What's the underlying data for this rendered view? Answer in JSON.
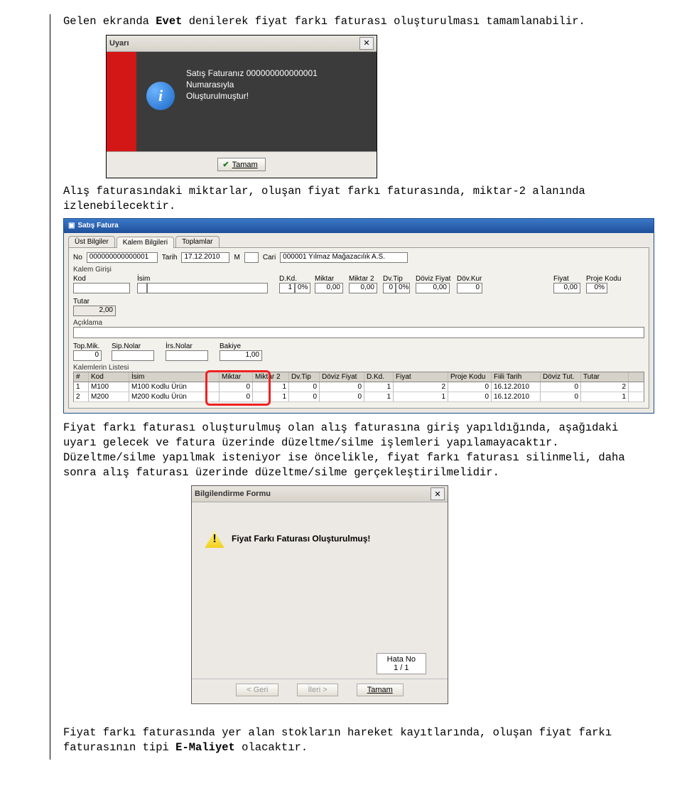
{
  "para1_a": "Gelen ekranda ",
  "para1_bold": "Evet",
  "para1_b": " denilerek fiyat farkı faturası oluşturulması tamamlanabilir.",
  "uyari": {
    "title": "Uyarı",
    "msg_line1": "Satış Faturanız 000000000000001 Numarasıyla",
    "msg_line2": "Oluşturulmuştur!",
    "tamam": "Tamam"
  },
  "para2": "Alış faturasındaki miktarlar, oluşan fiyat farkı faturasında, miktar-2 alanında izlenebilecektir.",
  "satis": {
    "title": "Satış Fatura",
    "tabs": [
      "Üst Bilgiler",
      "Kalem Bilgileri",
      "Toplamlar"
    ],
    "no_lbl": "No",
    "no": "000000000000001",
    "tarih_lbl": "Tarih",
    "tarih": "17.12.2010",
    "m_lbl": "M",
    "cari_lbl": "Cari",
    "cari": "000001 Yılmaz Mağazacılık A.S.",
    "kalem_girisi": "Kalem Girişi",
    "kod_lbl": "Kod",
    "isim_lbl": "İsim",
    "hdrs": {
      "dkd": "D.Kd.",
      "miktar": "Miktar",
      "miktar2": "Miktar 2",
      "dvtip": "Dv.Tip",
      "dovizfiyat": "Döviz Fiyat",
      "dovkur": "Döv.Kur",
      "fiyat": "Fiyat",
      "proje": "Proje Kodu"
    },
    "vals": {
      "dkd": "1",
      "dkd_pct": "0%",
      "miktar": "0,00",
      "miktar2": "0,00",
      "dvtip": "0",
      "dvtip_s": "0%",
      "dovizfiyat": "0,00",
      "dovkur": "0",
      "fiyat": "0,00",
      "proje": "0%"
    },
    "tutar_lbl": "Tutar",
    "tutar": "2,00",
    "aciklama_lbl": "Açıklama",
    "topmik": "Top.Mik.",
    "sipnolar": "Sip.Nolar",
    "irsnolar": "İrs.Nolar",
    "bakiye": "Bakiye",
    "topmik_v": "0",
    "bakiye_v": "1,00",
    "liste": "Kalemlerin Listesi",
    "cols": [
      "#",
      "Kod",
      "İsim",
      "Miktar",
      "Miktar 2",
      "Dv.Tip",
      "Döviz Fiyat",
      "D.Kd.",
      "Fiyat",
      "Proje Kodu",
      "Fiili Tarih",
      "Döviz Tut.",
      "Tutar"
    ],
    "rows": [
      {
        "n": "1",
        "kod": "M100",
        "isim": "M100 Kodlu Ürün",
        "miktar": "0",
        "miktar2": "1",
        "dvtip": "0",
        "dovizfiyat": "0",
        "dkd": "1",
        "fiyat": "2",
        "proje": "0",
        "tarih": "16.12.2010",
        "dvt": "0",
        "tutar": "2"
      },
      {
        "n": "2",
        "kod": "M200",
        "isim": "M200 Kodlu Ürün",
        "miktar": "0",
        "miktar2": "1",
        "dvtip": "0",
        "dovizfiyat": "0",
        "dkd": "1",
        "fiyat": "1",
        "proje": "0",
        "tarih": "16.12.2010",
        "dvt": "0",
        "tutar": "1"
      }
    ]
  },
  "para3": "Fiyat farkı faturası oluşturulmuş olan alış faturasına giriş yapıldığında, aşağıdaki uyarı gelecek ve fatura üzerinde düzeltme/silme işlemleri yapılamayacaktır. Düzeltme/silme yapılmak isteniyor ise öncelikle, fiyat farkı faturası silinmeli, daha sonra alış faturası üzerinde düzeltme/silme gerçekleştirilmelidir.",
  "bilgi": {
    "title": "Bilgilendirme Formu",
    "msg": "Fiyat Farkı Faturası Oluşturulmuş!",
    "hata_lbl": "Hata No",
    "hata_val": "1 / 1",
    "geri": "< Geri",
    "ileri": "İleri >",
    "tamam": "Tamam"
  },
  "para4_a": "Fiyat farkı faturasında yer alan stokların hareket kayıtlarında, oluşan fiyat farkı faturasının tipi ",
  "para4_bold": "E-Maliyet",
  "para4_b": " olacaktır."
}
